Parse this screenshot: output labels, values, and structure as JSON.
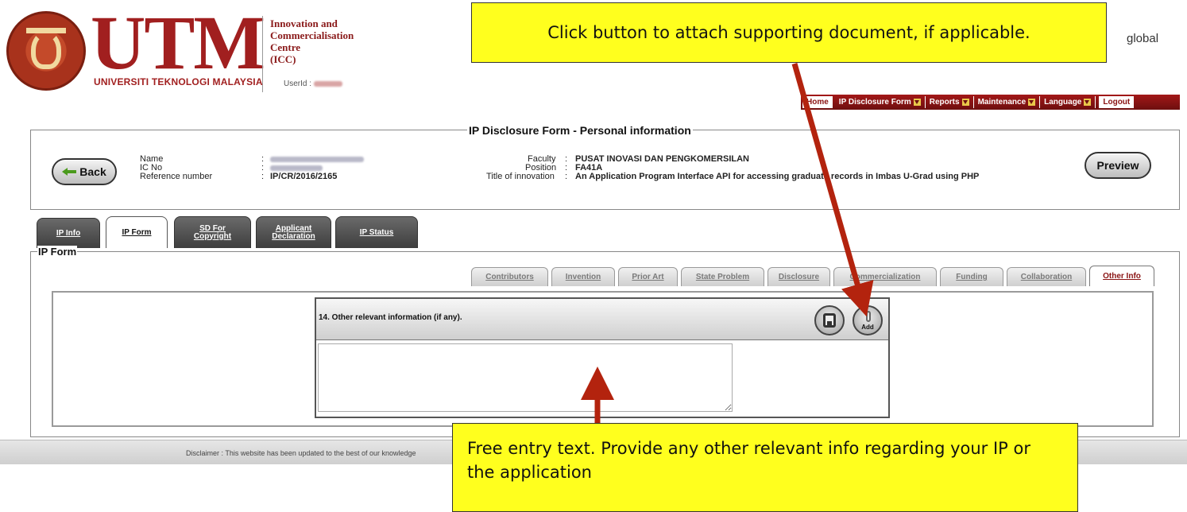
{
  "header": {
    "logo_word": "UTM",
    "university_name": "UNIVERSITI TEKNOLOGI MALAYSIA",
    "icc_lines": [
      "Innovation and",
      "Commercialisation",
      "Centre",
      "(ICC)"
    ],
    "userid_label": "UserId :",
    "tagline_fragment": "global"
  },
  "topnav": {
    "items": [
      {
        "label": "Home",
        "caret": false
      },
      {
        "label": "IP Disclosure Form",
        "caret": true
      },
      {
        "label": "Reports",
        "caret": true
      },
      {
        "label": "Maintenance",
        "caret": true
      },
      {
        "label": "Language",
        "caret": true
      },
      {
        "label": "Logout",
        "caret": false
      }
    ]
  },
  "personal_info": {
    "legend": "IP Disclosure Form - Personal information",
    "back_label": "Back",
    "preview_label": "Preview",
    "name_label": "Name",
    "ic_label": "IC No",
    "ref_label": "Reference number",
    "ref_value": "IP/CR/2016/2165",
    "colon": ":",
    "faculty_label": "Faculty",
    "faculty_value": "PUSAT INOVASI DAN PENGKOMERSILAN",
    "position_label": "Position",
    "position_value": "FA41A",
    "title_label": "Title of innovation",
    "title_value": "An Application Program Interface API for accessing graduate records in Imbas U-Grad using PHP"
  },
  "main_tabs": [
    {
      "label": "IP Info",
      "active": false
    },
    {
      "label": "IP Form",
      "active": true
    },
    {
      "label": "SD For Copyright",
      "active": false
    },
    {
      "label": "Applicant Declaration",
      "active": false
    },
    {
      "label": "IP Status",
      "active": false
    }
  ],
  "ip_form": {
    "legend": "IP Form",
    "sub_tabs": [
      {
        "label": "Contributors",
        "active": false
      },
      {
        "label": "Invention",
        "active": false
      },
      {
        "label": "Prior Art",
        "active": false
      },
      {
        "label": "State Problem",
        "active": false
      },
      {
        "label": "Disclosure",
        "active": false
      },
      {
        "label": "Commercialization",
        "active": false
      },
      {
        "label": "Funding",
        "active": false
      },
      {
        "label": "Collaboration",
        "active": false
      },
      {
        "label": "Other Info",
        "active": true
      }
    ],
    "question_title": "14. Other relevant information (if any).",
    "add_label": "Add",
    "answer_value": ""
  },
  "footer": {
    "disclaimer": "Disclaimer : This website has been updated to the best of our knowledge"
  },
  "callouts": {
    "top": "Click button to attach supporting document, if applicable.",
    "bottom": "Free entry text. Provide any other relevant info regarding your IP or the application",
    "color": "#ffff1e",
    "arrow_color": "#b3230e"
  },
  "colors": {
    "brand_red": "#a11f1f",
    "nav_red": "#8a1414"
  }
}
